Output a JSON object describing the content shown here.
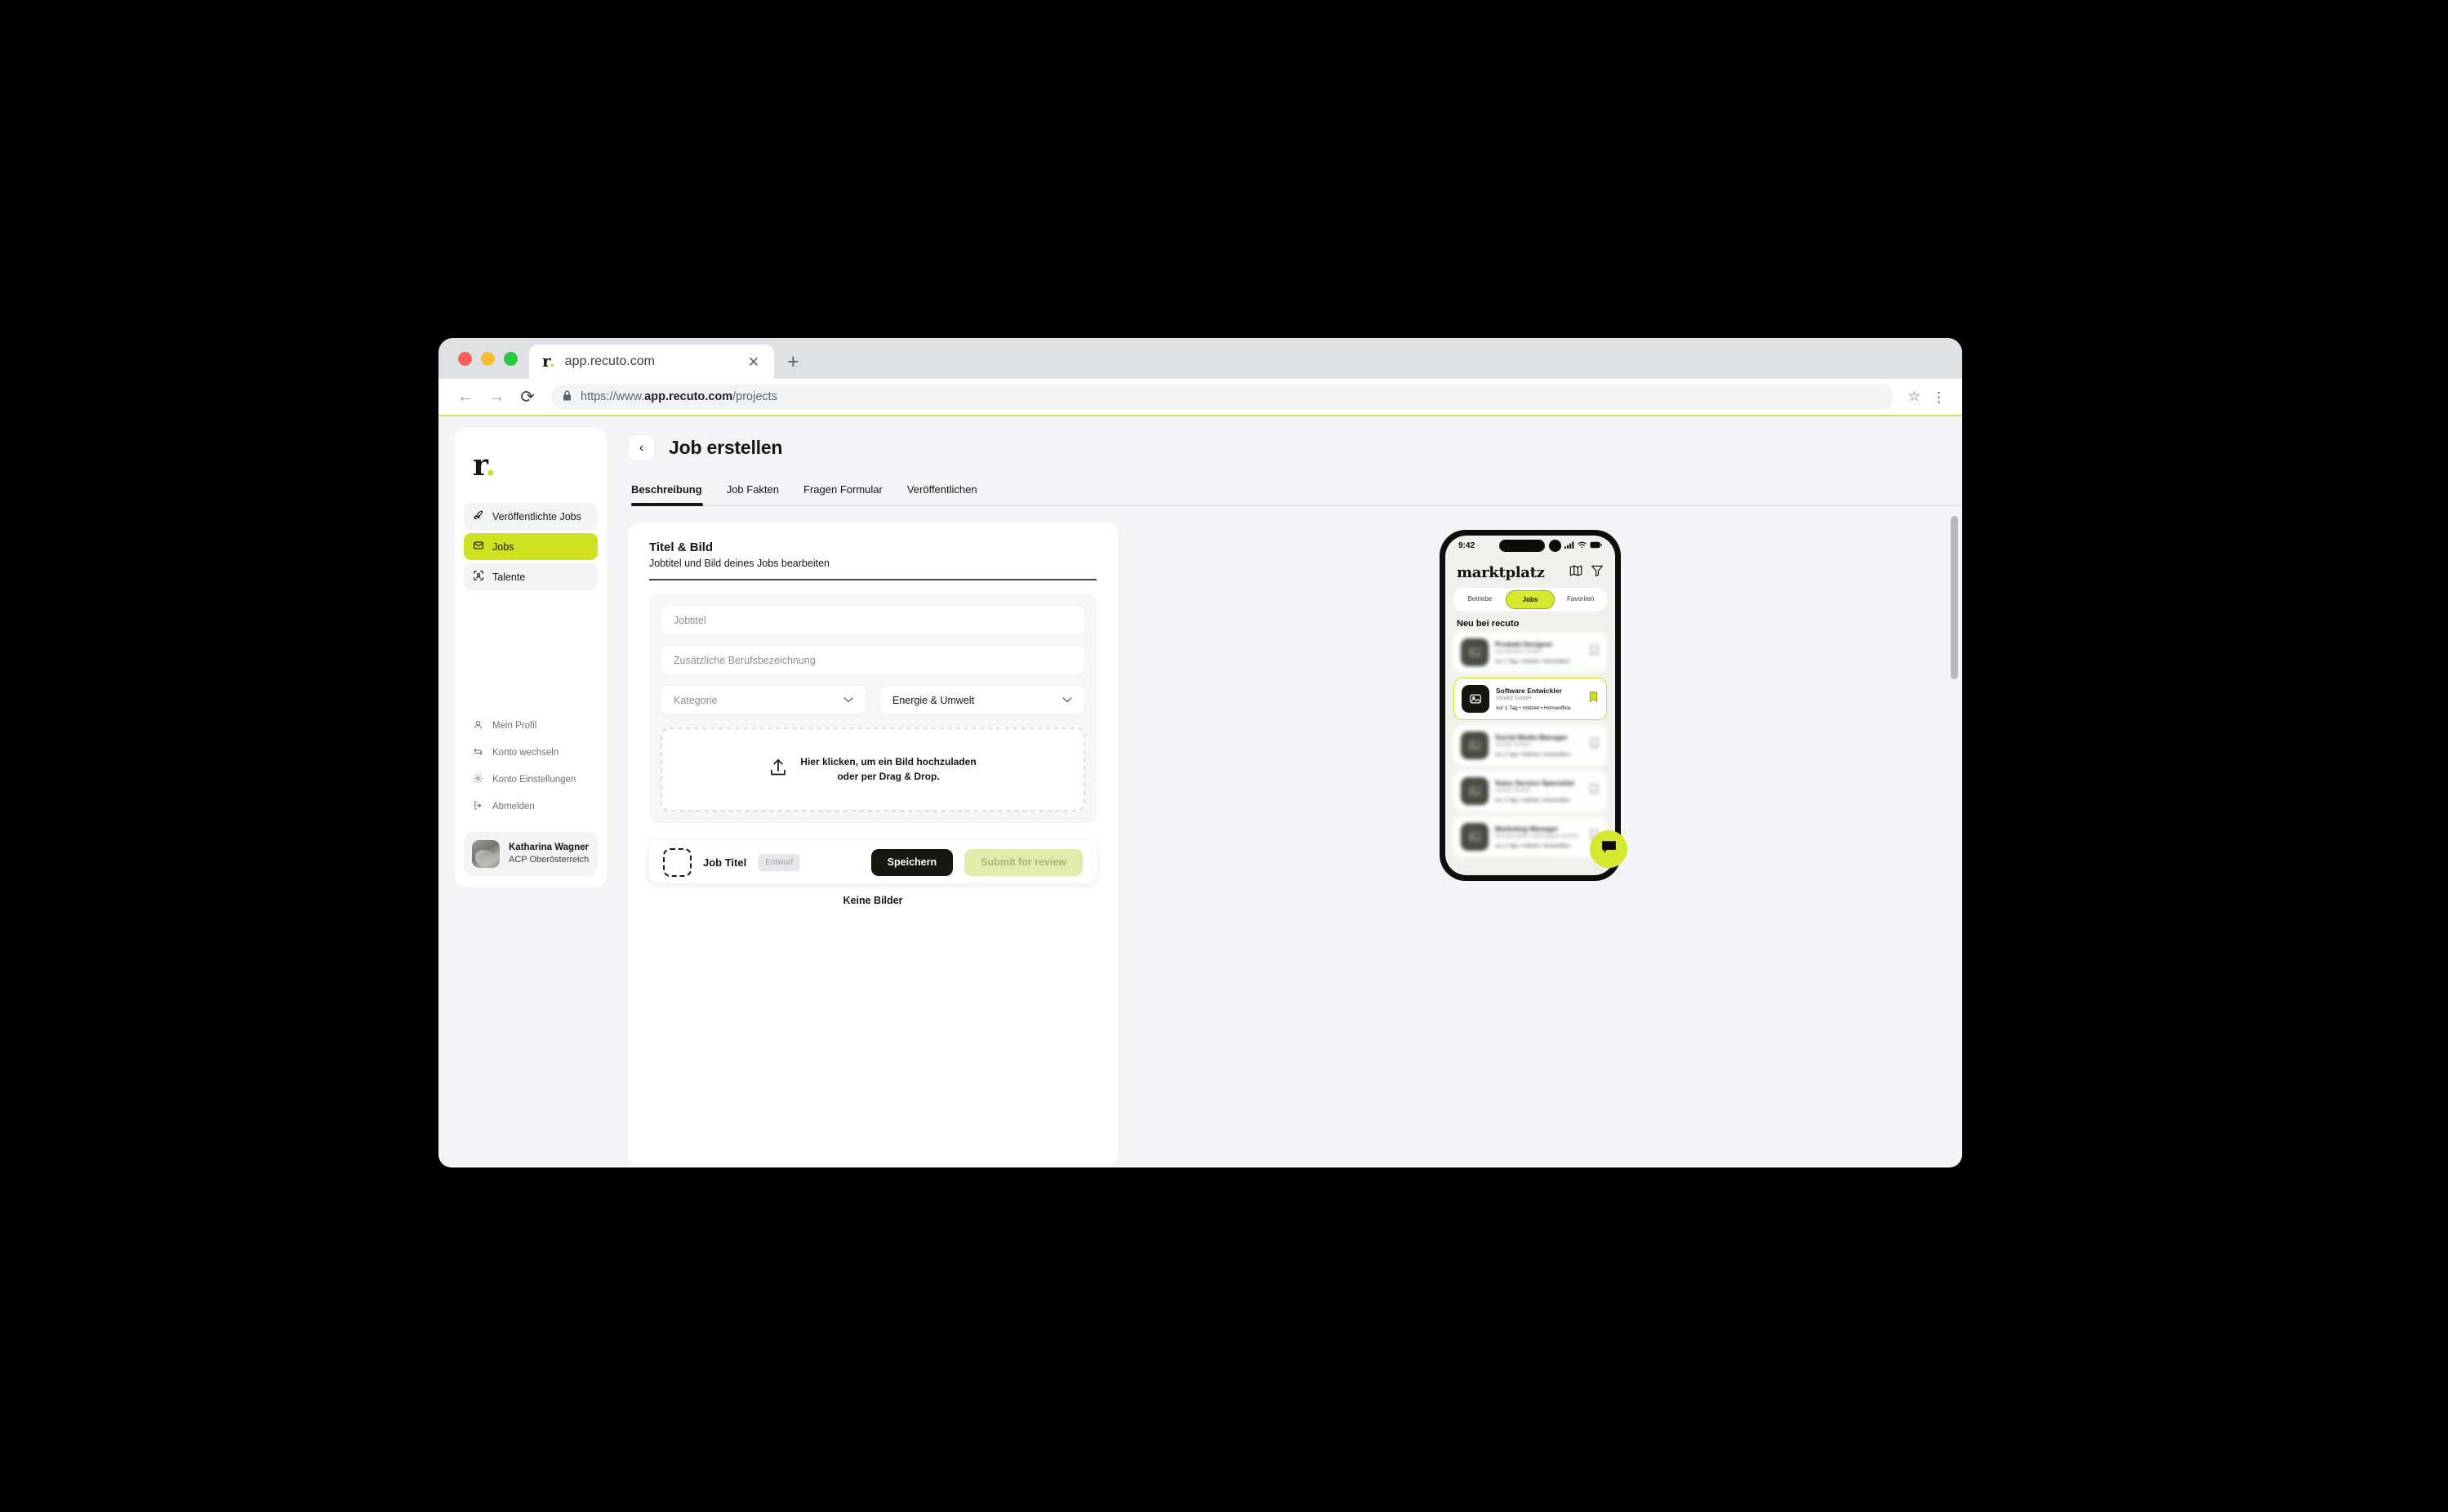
{
  "browser": {
    "tab_title": "app.recuto.com",
    "favicon_letter": "r",
    "favicon_dot": ".",
    "close_glyph": "✕",
    "new_tab_glyph": "+",
    "back_glyph": "←",
    "forward_glyph": "→",
    "reload_glyph": "⟳",
    "lock_glyph": "🔒",
    "url_prefix": "https://www.",
    "url_domain": "app.recuto.com",
    "url_path": "/projects",
    "star_glyph": "☆",
    "menu_glyph": "⋮"
  },
  "sidebar": {
    "brand": "r",
    "brand_dot": ".",
    "items": [
      {
        "label": "Veröffentlichte Jobs",
        "icon": "rocket-icon",
        "active": false
      },
      {
        "label": "Jobs",
        "icon": "inbox-icon",
        "active": true
      },
      {
        "label": "Talente",
        "icon": "talent-scan-icon",
        "active": false
      }
    ],
    "sub_items": [
      {
        "label": "Mein Profil",
        "icon": "user-icon"
      },
      {
        "label": "Konto wechseln",
        "icon": "swap-icon"
      },
      {
        "label": "Konto Einstellungen",
        "icon": "gear-icon"
      },
      {
        "label": "Abmelden",
        "icon": "logout-icon"
      }
    ],
    "user": {
      "name": "Katharina Wagner",
      "org": "ACP Oberösterreich"
    }
  },
  "header": {
    "back_glyph": "‹",
    "title": "Job erstellen",
    "tabs": [
      {
        "label": "Beschreibung",
        "active": true
      },
      {
        "label": "Job Fakten",
        "active": false
      },
      {
        "label": "Fragen Formular",
        "active": false
      },
      {
        "label": "Veröffentlichen",
        "active": false
      }
    ]
  },
  "form": {
    "card_title": "Titel & Bild",
    "card_subtitle": "Jobtitel und Bild deines Jobs bearbeiten",
    "job_title_placeholder": "Jobtitel",
    "extra_title_placeholder": "Zusätzliche Berufsbezeichnung",
    "category_placeholder": "Kategorie",
    "category_value": "Energie & Umwelt",
    "chevron_glyph": "⌄",
    "dropzone_line1": "Hier klicken, um ein Bild hochzuladen",
    "dropzone_line2": "oder per Drag & Drop.",
    "no_images": "Keine Bilder"
  },
  "actionbar": {
    "job_title": "Job Titel",
    "status_badge": "Entwurf",
    "save_label": "Speichern",
    "submit_label": "Submit for review"
  },
  "phone": {
    "status_time": "9:42",
    "app_title": "marktplatz",
    "icons": {
      "map": "map-icon",
      "filter": "filter-icon"
    },
    "segments": [
      {
        "label": "Betriebe",
        "active": false
      },
      {
        "label": "Jobs",
        "active": true
      },
      {
        "label": "Favoriten",
        "active": false
      }
    ],
    "section_title": "Neu bei recuto",
    "jobs": [
      {
        "title": "Produkt Designer",
        "company": "wundertbar GmbH",
        "meta": "vor 1 Tag • Vollzeit • Homeoffice",
        "highlighted": false
      },
      {
        "title": "Software Entwickler",
        "company": "vondot GmbH",
        "meta": "vor 1 Tag • Vollzeit • Homeoffice",
        "highlighted": true
      },
      {
        "title": "Social Media Manager",
        "company": "vondot GmbH",
        "meta": "vor 1 Tag • Vollzeit • Homeoffice",
        "highlighted": false
      },
      {
        "title": "Sales Service Specialist",
        "company": "vondot GmbH",
        "meta": "vor 1 Tag • Vollzeit • Homeoffice",
        "highlighted": false
      },
      {
        "title": "Marketing Manager",
        "company": "Wundersoftly Lebenspark GmbH",
        "meta": "vor 1 Tag • Vollzeit • Homeoffice",
        "highlighted": false
      }
    ]
  },
  "colors": {
    "accent_lime": "#cfe11f",
    "phone_lime": "#d7e830",
    "dark": "#16170f",
    "page_bg": "#f3f4f8"
  }
}
